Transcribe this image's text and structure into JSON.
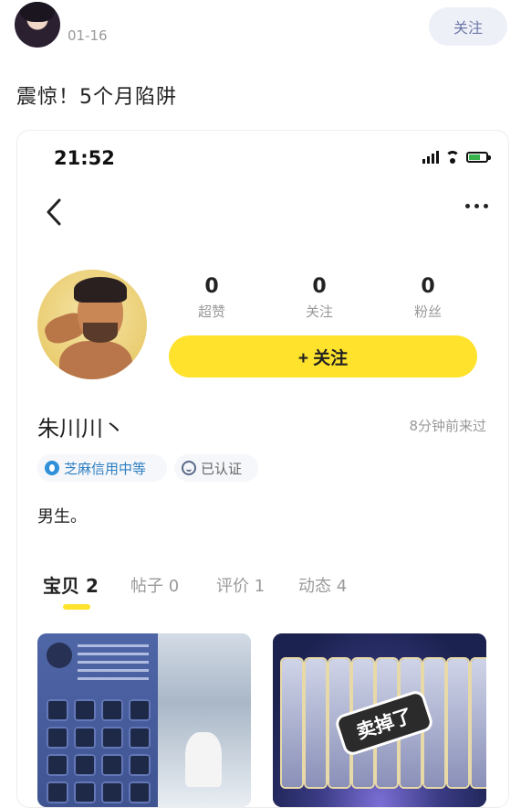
{
  "post": {
    "date": "01-16",
    "follow_label": "关注",
    "title": "震惊！5个月陷阱"
  },
  "screenshot": {
    "status_time": "21:52",
    "profile": {
      "stats": [
        {
          "value": "0",
          "label": "超赞"
        },
        {
          "value": "0",
          "label": "关注"
        },
        {
          "value": "0",
          "label": "粉丝"
        }
      ],
      "follow_button": "+ 关注",
      "username": "朱川川丶",
      "last_seen": "8分钟前来过",
      "badges": {
        "credit": "芝麻信用中等",
        "verified": "已认证"
      },
      "bio": "男生。"
    },
    "tabs": [
      {
        "label": "宝贝",
        "count": "2"
      },
      {
        "label": "帖子",
        "count": "0"
      },
      {
        "label": "评价",
        "count": "1"
      },
      {
        "label": "动态",
        "count": "4"
      }
    ],
    "cards": {
      "right_stamp": "卖掉了"
    }
  },
  "colors": {
    "accent_yellow": "#ffe22b",
    "follow_small_bg": "#eef0f8",
    "credit_blue": "#2f7fc2"
  },
  "icons": [
    "back-icon",
    "more-icon",
    "signal-icon",
    "wifi-icon",
    "battery-icon",
    "zhima-icon",
    "verified-icon"
  ]
}
